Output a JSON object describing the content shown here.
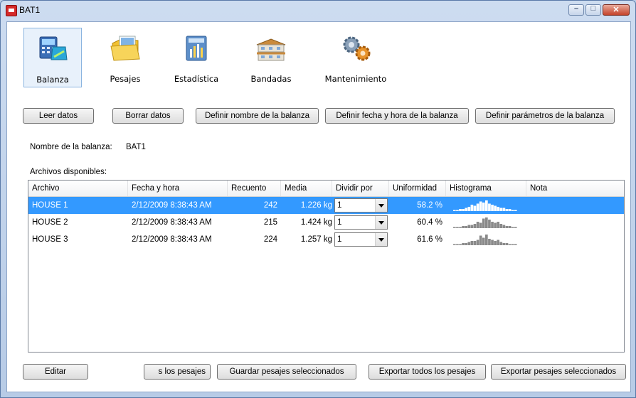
{
  "window": {
    "title": "BAT1"
  },
  "toolbar": [
    {
      "label": "Balanza",
      "icon": "scale-icon"
    },
    {
      "label": "Pesajes",
      "icon": "folder-icon"
    },
    {
      "label": "Estadística",
      "icon": "statistics-icon"
    },
    {
      "label": "Bandadas",
      "icon": "barn-icon"
    },
    {
      "label": "Mantenimiento",
      "icon": "gears-icon"
    }
  ],
  "actions": {
    "read": "Leer datos",
    "erase": "Borrar datos",
    "set_name": "Definir nombre de la balanza",
    "set_datetime": "Definir fecha y hora de la balanza",
    "set_params": "Definir parámetros de la balanza"
  },
  "scale": {
    "name_label": "Nombre de la balanza:",
    "name_value": "BAT1"
  },
  "files": {
    "label": "Archivos disponibles:",
    "columns": [
      "Archivo",
      "Fecha y hora",
      "Recuento",
      "Media",
      "Dividir por",
      "Uniformidad",
      "Histograma",
      "Nota"
    ],
    "rows": [
      {
        "archivo": "HOUSE 1",
        "fecha": "2/12/2009 8:38:43 AM",
        "recuento": "242",
        "media": "1.226 kg",
        "dividir": "1",
        "uniformidad": "58.2 %",
        "hist": [
          1,
          1,
          2,
          2,
          3,
          4,
          6,
          5,
          7,
          9,
          8,
          10,
          7,
          6,
          5,
          4,
          3,
          3,
          2,
          2,
          1,
          1
        ],
        "nota": ""
      },
      {
        "archivo": "HOUSE 2",
        "fecha": "2/12/2009 8:38:43 AM",
        "recuento": "215",
        "media": "1.424 kg",
        "dividir": "1",
        "uniformidad": "60.4 %",
        "hist": [
          1,
          1,
          1,
          2,
          2,
          3,
          3,
          4,
          6,
          5,
          9,
          10,
          8,
          6,
          5,
          6,
          4,
          3,
          2,
          2,
          1,
          1
        ],
        "nota": ""
      },
      {
        "archivo": "HOUSE 3",
        "fecha": "2/12/2009 8:38:43 AM",
        "recuento": "224",
        "media": "1.257 kg",
        "dividir": "1",
        "uniformidad": "61.6 %",
        "hist": [
          1,
          1,
          1,
          2,
          2,
          3,
          4,
          4,
          5,
          9,
          7,
          10,
          6,
          5,
          4,
          5,
          3,
          2,
          2,
          1,
          1,
          1
        ],
        "nota": ""
      }
    ]
  },
  "bottom": {
    "edit": "Editar",
    "save_all": "s los pesajes",
    "save_selected": "Guardar pesajes seleccionados",
    "export_all": "Exportar todos los pesajes",
    "export_selected": "Exportar pesajes seleccionados"
  },
  "colors": {
    "selection": "#3399ff",
    "histogram": "#8a8a8a"
  }
}
